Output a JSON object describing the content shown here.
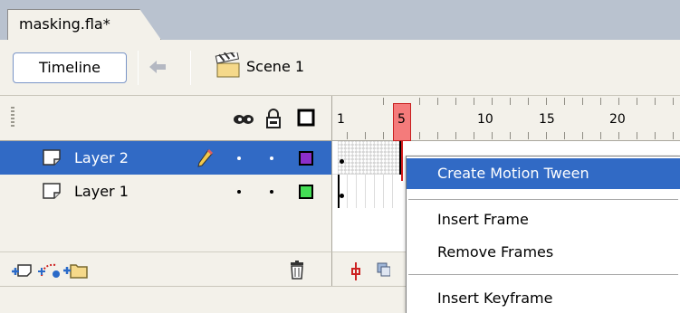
{
  "document_tab": {
    "label": "masking.fla*"
  },
  "toolbar": {
    "timeline_label": "Timeline",
    "scene_label": "Scene 1"
  },
  "ruler": {
    "labels": [
      "1",
      "5",
      "10",
      "15",
      "20"
    ],
    "current_frame": 5
  },
  "layers": [
    {
      "name": "Layer 2",
      "selected": true,
      "swatch_color": "#8b2fc9"
    },
    {
      "name": "Layer 1",
      "selected": false,
      "swatch_color": "#44dd55"
    }
  ],
  "context_menu": {
    "items": [
      "Create Motion Tween",
      "Insert Frame",
      "Remove Frames",
      "Insert Keyframe"
    ],
    "highlighted_index": 0
  },
  "colors": {
    "selection": "#316ac5",
    "panel": "#f3f1ea",
    "background": "#b9c2cf",
    "playhead": "#f47b7b"
  }
}
